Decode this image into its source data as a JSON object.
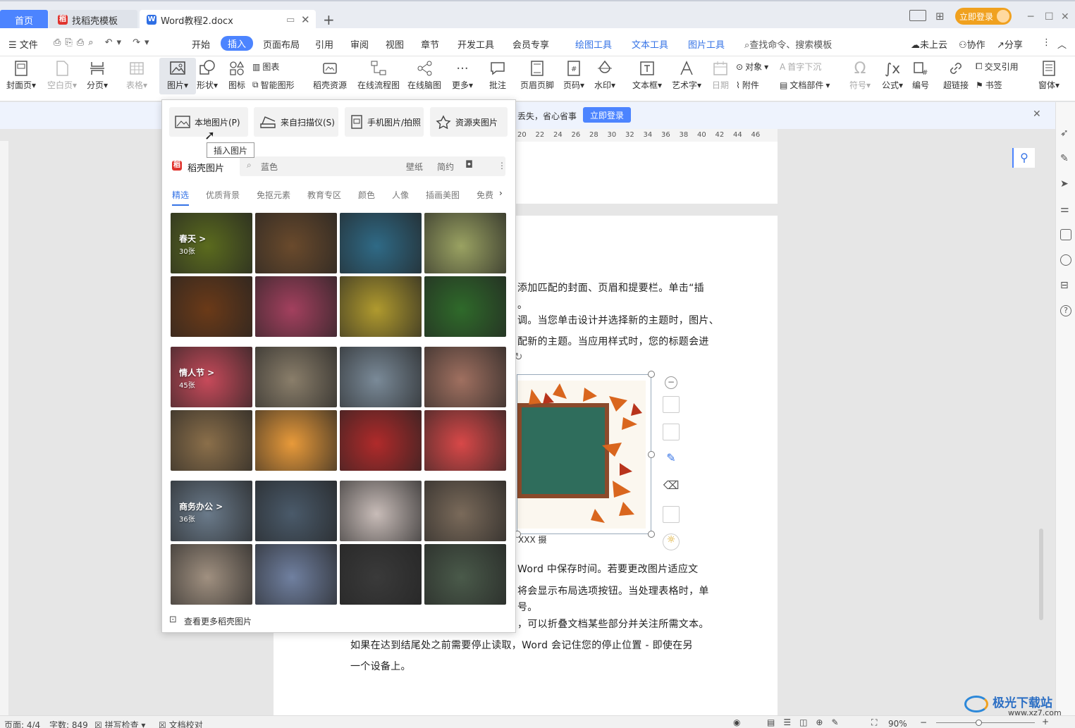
{
  "tabs": {
    "home": "首页",
    "templates": "找稻壳模板",
    "document": "Word教程2.docx",
    "new_tab": "+"
  },
  "titlebar": {
    "login": "立即登录"
  },
  "menu": {
    "file": "文件",
    "items": [
      "开始",
      "插入",
      "页面布局",
      "引用",
      "审阅",
      "视图",
      "章节",
      "开发工具",
      "会员专享"
    ],
    "active": "插入",
    "tools": [
      "绘图工具",
      "文本工具",
      "图片工具"
    ],
    "search": "查找命令、搜索模板",
    "cloud": "未上云",
    "collab": "协作",
    "share": "分享"
  },
  "ribbon": {
    "cover": "封面页",
    "blank": "空白页",
    "pagebreak": "分页",
    "table": "表格",
    "picture": "图片",
    "shape": "形状",
    "icon": "图标",
    "chart": "图表",
    "smart": "智能图形",
    "resource": "稻壳资源",
    "flow": "在线流程图",
    "mind": "在线脑图",
    "more": "更多",
    "comment": "批注",
    "headerfooter": "页眉页脚",
    "pagenum": "页码",
    "watermark": "水印",
    "textbox": "文本框",
    "arttext": "艺术字",
    "date": "日期",
    "object": "对象",
    "dropcap": "首字下沉",
    "attach": "附件",
    "docpart": "文档部件",
    "symbol": "符号",
    "formula": "公式",
    "numbering": "编号",
    "hyperlink": "超链接",
    "crossref": "交叉引用",
    "bookmark": "书签",
    "window": "窗体"
  },
  "notice": {
    "text": "丢失，省心省事",
    "button": "立即登录"
  },
  "ruler_ticks": [
    "20",
    "22",
    "24",
    "26",
    "28",
    "30",
    "32",
    "34",
    "36",
    "38",
    "40",
    "42",
    "44",
    "46"
  ],
  "popup": {
    "local": "本地图片(P)",
    "scanner": "来自扫描仪(S)",
    "phone": "手机图片/拍照",
    "folder": "资源夹图片",
    "tooltip": "插入图片",
    "brand": "稻壳图片",
    "search_placeholder": "蓝色",
    "tag_wallpaper": "壁纸",
    "tag_simple": "简约",
    "categories": [
      "精选",
      "优质背景",
      "免抠元素",
      "教育专区",
      "颜色",
      "人像",
      "插画美图",
      "免费"
    ],
    "groups": [
      {
        "title": "春天 >",
        "count": "30张"
      },
      {
        "title": "情人节 >",
        "count": "45张"
      },
      {
        "title": "商务办公 >",
        "count": "36张"
      }
    ],
    "more": "查看更多稻壳图片"
  },
  "document": {
    "lines": [
      "添加匹配的封面、页眉和提要栏。单击“插",
      "。",
      "调。当您单击设计并选择新的主题时，图片、",
      "配新的主题。当应用样式时，您的标题会进",
      "Word 中保存时间。若要更改图片适应文",
      "将会显示布局选项按钮。当处理表格时，单",
      "号。",
      "，可以折叠文档某些部分并关注所需文本。",
      "如果在达到结尾处之前需要停止读取，Word 会记住您的停止位置 - 即使在另",
      "一个设备上。"
    ],
    "caption": "XXX 摄"
  },
  "statusbar": {
    "page": "页面: 4/4",
    "words": "字数: 849",
    "spell": "拼写检查",
    "proof": "文档校对",
    "zoom": "90%"
  },
  "watermark": {
    "site": "极光下载站",
    "url": "www.xz7.com"
  },
  "colors": {
    "accent": "#4c84ff",
    "login": "#f0a11f"
  }
}
